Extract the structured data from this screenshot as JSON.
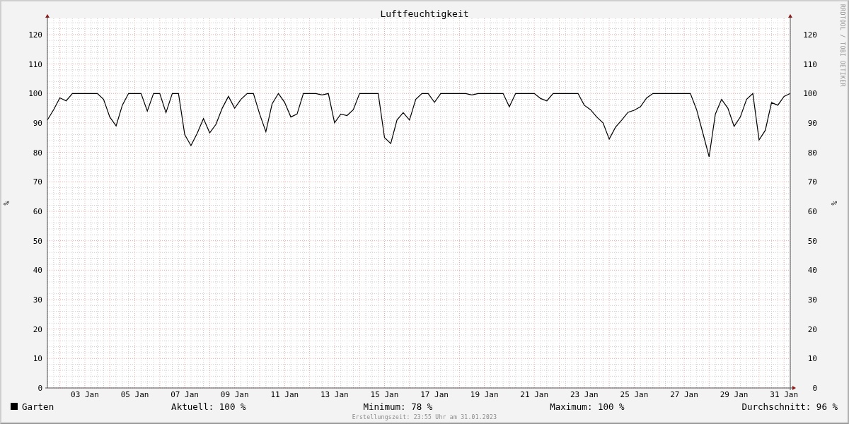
{
  "chart_data": {
    "type": "line",
    "grid": true,
    "title": "Luftfeuchtigkeit",
    "ylabel": "%",
    "ylim": [
      0,
      125.5
    ],
    "categories": [
      null,
      null,
      null,
      null,
      null,
      null,
      "03 Jan",
      null,
      null,
      null,
      null,
      null,
      null,
      null,
      "05 Jan",
      null,
      null,
      null,
      null,
      null,
      null,
      null,
      "07 Jan",
      null,
      null,
      null,
      null,
      null,
      null,
      null,
      "09 Jan",
      null,
      null,
      null,
      null,
      null,
      null,
      null,
      "11 Jan",
      null,
      null,
      null,
      null,
      null,
      null,
      null,
      "13 Jan",
      null,
      null,
      null,
      null,
      null,
      null,
      null,
      "15 Jan",
      null,
      null,
      null,
      null,
      null,
      null,
      null,
      "17 Jan",
      null,
      null,
      null,
      null,
      null,
      null,
      null,
      "19 Jan",
      null,
      null,
      null,
      null,
      null,
      null,
      null,
      "21 Jan",
      null,
      null,
      null,
      null,
      null,
      null,
      null,
      "23 Jan",
      null,
      null,
      null,
      null,
      null,
      null,
      null,
      "25 Jan",
      null,
      null,
      null,
      null,
      null,
      null,
      null,
      "27 Jan",
      null,
      null,
      null,
      null,
      null,
      null,
      null,
      "29 Jan",
      null,
      null,
      null,
      null,
      null,
      null,
      null,
      "31 Jan",
      null
    ],
    "yticks": [
      0,
      10,
      20,
      30,
      40,
      50,
      60,
      70,
      80,
      90,
      100,
      110,
      120
    ],
    "series": [
      {
        "name": "Garten",
        "color": "#000000",
        "values": [
          91,
          94.5,
          98.5,
          97.5,
          100,
          100,
          100,
          100,
          100,
          98,
          92,
          89,
          96,
          100,
          100,
          100,
          94,
          100,
          100,
          93.5,
          100,
          100,
          86,
          82.3,
          86.5,
          91.5,
          86.6,
          89.5,
          95,
          99,
          95,
          98,
          100,
          100,
          93,
          87,
          96.5,
          100,
          97,
          92,
          93,
          100,
          100,
          100,
          99.5,
          100,
          90,
          93,
          92.5,
          94.5,
          100,
          100,
          100,
          100,
          85,
          83,
          91,
          93.5,
          91,
          98,
          100,
          100,
          97,
          100,
          100,
          100,
          100,
          100,
          99.5,
          100,
          100,
          100,
          100,
          100,
          95.5,
          100,
          100,
          100,
          100,
          98.3,
          97.5,
          100,
          100,
          100,
          100,
          100,
          96,
          94.5,
          92,
          90,
          84.5,
          88.5,
          91,
          93.6,
          94.3,
          95.5,
          98.5,
          100,
          100,
          100,
          100,
          100,
          100,
          100,
          94.5,
          86.5,
          78.5,
          93,
          98,
          95,
          88.8,
          92,
          98,
          100,
          84.2,
          87.5,
          96.9,
          96,
          99,
          100
        ]
      }
    ]
  },
  "right_axis": {
    "label": "%",
    "ticks": [
      "120",
      "110",
      "100",
      "90",
      "80",
      "70",
      "60",
      "50",
      "40",
      "30",
      "20",
      "10",
      "0"
    ]
  },
  "credit": "RRDTOOL / TOBI OETIKER",
  "stats": [
    {
      "label": "Aktuell:",
      "value": "100 %"
    },
    {
      "label": "Minimum:",
      "value": "78 %"
    },
    {
      "label": "Maximum:",
      "value": "100 %"
    },
    {
      "label": "Durchschnitt:",
      "value": "96 %"
    }
  ],
  "footer": "Erstellungszeit: 23:55 Uhr am 31.01.2023"
}
